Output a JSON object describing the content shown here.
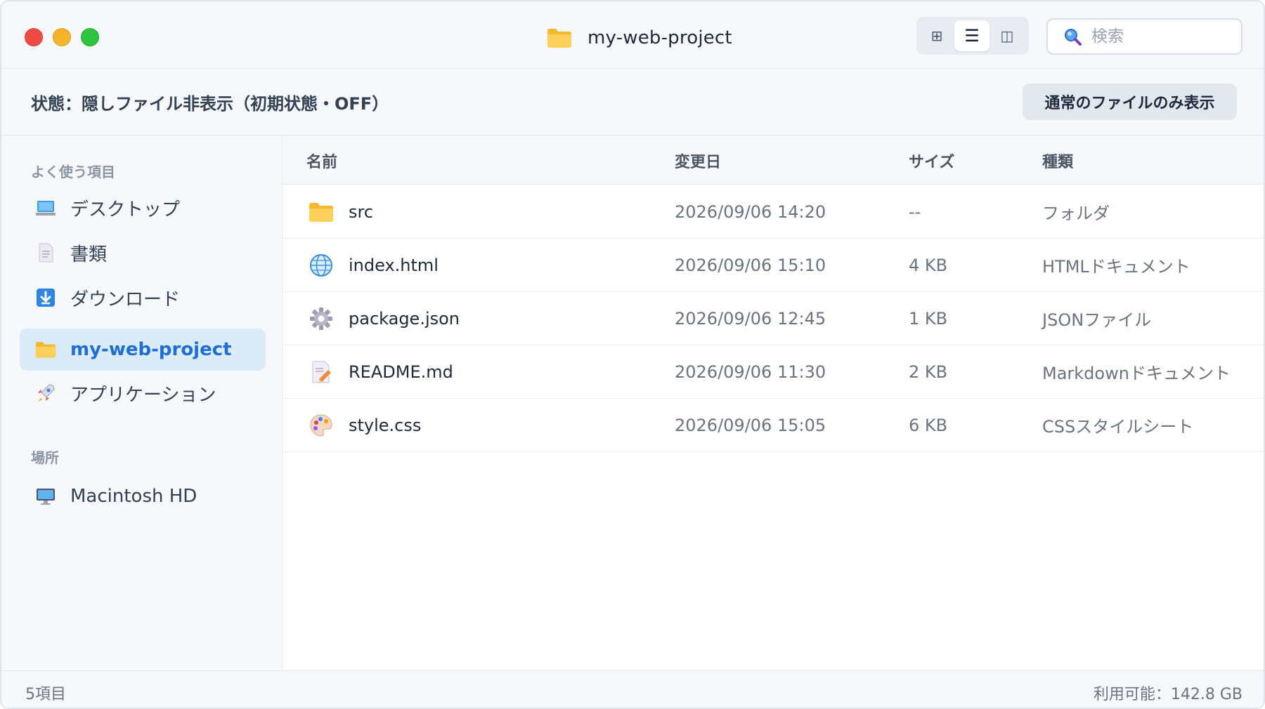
{
  "window": {
    "title": "my-web-project"
  },
  "toolbar": {
    "view_buttons": [
      {
        "name": "grid-view",
        "glyph": "⊞"
      },
      {
        "name": "list-view",
        "glyph": "☰",
        "active": true
      },
      {
        "name": "column-view",
        "glyph": "◫"
      }
    ],
    "search_placeholder": "検索"
  },
  "status": {
    "text": "状態：隠しファイル非表示（初期状態・OFF）",
    "toggle_label": "通常のファイルのみ表示"
  },
  "sidebar": {
    "favorites_heading": "よく使う項目",
    "favorites": [
      {
        "label": "デスクトップ",
        "icon": "desktop-icon"
      },
      {
        "label": "書類",
        "icon": "document-icon"
      },
      {
        "label": "ダウンロード",
        "icon": "download-icon"
      },
      {
        "label": "my-web-project",
        "icon": "folder-icon",
        "selected": true
      },
      {
        "label": "アプリケーション",
        "icon": "rocket-icon"
      }
    ],
    "locations_heading": "場所",
    "locations": [
      {
        "label": "Macintosh HD",
        "icon": "computer-icon"
      }
    ]
  },
  "table": {
    "columns": [
      "名前",
      "変更日",
      "サイズ",
      "種類"
    ],
    "rows": [
      {
        "name": "src",
        "modified": "2026/09/06 14:20",
        "size": "--",
        "kind": "フォルダ",
        "icon": "folder-icon"
      },
      {
        "name": "index.html",
        "modified": "2026/09/06 15:10",
        "size": "4 KB",
        "kind": "HTMLドキュメント",
        "icon": "globe-icon"
      },
      {
        "name": "package.json",
        "modified": "2026/09/06 12:45",
        "size": "1 KB",
        "kind": "JSONファイル",
        "icon": "gear-icon"
      },
      {
        "name": "README.md",
        "modified": "2026/09/06 11:30",
        "size": "2 KB",
        "kind": "Markdownドキュメント",
        "icon": "memo-icon"
      },
      {
        "name": "style.css",
        "modified": "2026/09/06 15:05",
        "size": "6 KB",
        "kind": "CSSスタイルシート",
        "icon": "palette-icon"
      }
    ]
  },
  "footer": {
    "item_count": "5項目",
    "available": "利用可能：142.8 GB"
  },
  "colors": {
    "accent": "#1d6fd6",
    "selected_bg": "#dcebf8",
    "folder": "#f8c33d"
  }
}
